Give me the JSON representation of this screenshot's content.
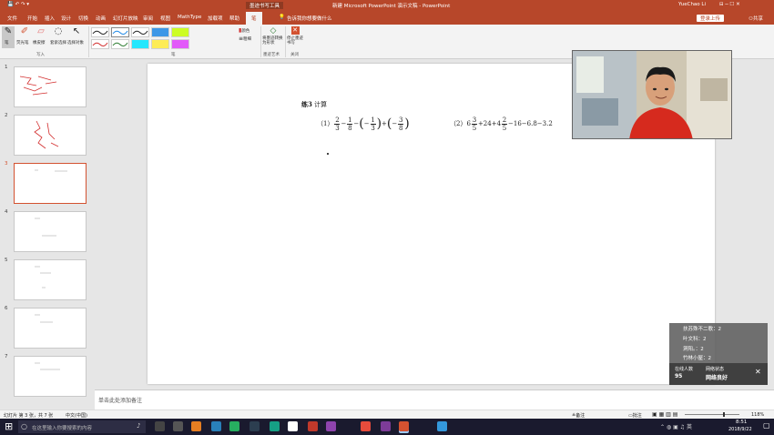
{
  "titlebar": {
    "left_context": "墨迹书写工具",
    "doc_title": "新建 Microsoft PowerPoint 演示文稿 - PowerPoint",
    "user": "YueChao Li",
    "share_label": "登录上传"
  },
  "menu": {
    "tabs": [
      "文件",
      "开始",
      "插入",
      "设计",
      "切换",
      "动画",
      "幻灯片放映",
      "审阅",
      "视图",
      "MathType",
      "加载项",
      "帮助",
      "笔"
    ],
    "active_tab": "笔",
    "tell_me": "告诉我你想要做什么",
    "share": "共享"
  },
  "ribbon": {
    "pen_tool": "笔",
    "highlighter": "荧光笔",
    "eraser": "橡皮擦",
    "lasso": "套索选择",
    "select": "选择对象",
    "group_write": "写入",
    "group_pens": "笔",
    "color_label": "颜色",
    "thickness_label": "粗细",
    "convert_label": "将墨迹转换为形状",
    "group_convert": "墨迹艺术",
    "stop_label": "停止墨迹书写",
    "group_close": "关闭",
    "pen_colors": [
      "#222222",
      "#d32f2f",
      "#1e88e5",
      "#2e7d32",
      "#222222",
      "#00e5ff",
      "#1e88e5",
      "#ffeb3b",
      "#c6ff00",
      "#e040fb"
    ]
  },
  "slides": [
    {
      "num": "1"
    },
    {
      "num": "2"
    },
    {
      "num": "3"
    },
    {
      "num": "4"
    },
    {
      "num": "5"
    },
    {
      "num": "6"
    },
    {
      "num": "7"
    }
  ],
  "slide": {
    "heading_bold": "练3",
    "heading_text": "计算",
    "p1_label": "（1）",
    "p2_label": "（2）",
    "f1n": "2",
    "f1d": "3",
    "f2n": "1",
    "f2d": "8",
    "f3n": "1",
    "f3d": "3",
    "f4n": "3",
    "f4d": "8",
    "p2_whole": "6",
    "p2_f1n": "3",
    "p2_f1d": "5",
    "p2_mid": "+24+4",
    "p2_f2n": "2",
    "p2_f2d": "5",
    "p2_tail": "−16−6.8−3.2"
  },
  "notes_placeholder": "单击此处添加备注",
  "status": {
    "slide_info": "幻灯片 第 3 张，共 7 张",
    "lang": "中文(中国)",
    "notes_btn": "备注",
    "comments_btn": "批注",
    "zoom": "118%"
  },
  "chat": {
    "lines": [
      "扶苏殊不二歌：2",
      "叶文科：2",
      "洞阳。：2",
      "竹林小屋：2"
    ],
    "count_label": "在线人数",
    "count": "95",
    "net_label": "网络状态",
    "net_value": "网络良好"
  },
  "taskbar": {
    "search_placeholder": "在这里输入你要搜索的内容",
    "time": "8:51",
    "date": "2018/9/22"
  }
}
